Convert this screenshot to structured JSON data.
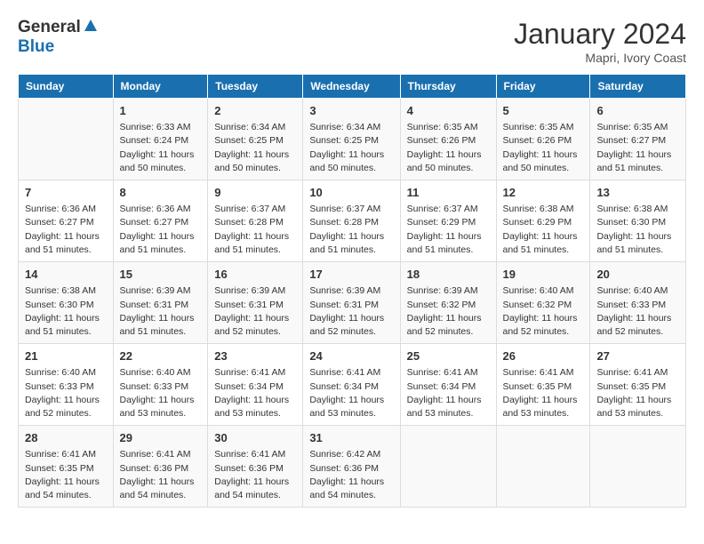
{
  "header": {
    "logo_general": "General",
    "logo_blue": "Blue",
    "month_title": "January 2024",
    "location": "Mapri, Ivory Coast"
  },
  "weekdays": [
    "Sunday",
    "Monday",
    "Tuesday",
    "Wednesday",
    "Thursday",
    "Friday",
    "Saturday"
  ],
  "rows": [
    [
      {
        "day": "",
        "info": ""
      },
      {
        "day": "1",
        "info": "Sunrise: 6:33 AM\nSunset: 6:24 PM\nDaylight: 11 hours\nand 50 minutes."
      },
      {
        "day": "2",
        "info": "Sunrise: 6:34 AM\nSunset: 6:25 PM\nDaylight: 11 hours\nand 50 minutes."
      },
      {
        "day": "3",
        "info": "Sunrise: 6:34 AM\nSunset: 6:25 PM\nDaylight: 11 hours\nand 50 minutes."
      },
      {
        "day": "4",
        "info": "Sunrise: 6:35 AM\nSunset: 6:26 PM\nDaylight: 11 hours\nand 50 minutes."
      },
      {
        "day": "5",
        "info": "Sunrise: 6:35 AM\nSunset: 6:26 PM\nDaylight: 11 hours\nand 50 minutes."
      },
      {
        "day": "6",
        "info": "Sunrise: 6:35 AM\nSunset: 6:27 PM\nDaylight: 11 hours\nand 51 minutes."
      }
    ],
    [
      {
        "day": "7",
        "info": "Sunrise: 6:36 AM\nSunset: 6:27 PM\nDaylight: 11 hours\nand 51 minutes."
      },
      {
        "day": "8",
        "info": "Sunrise: 6:36 AM\nSunset: 6:27 PM\nDaylight: 11 hours\nand 51 minutes."
      },
      {
        "day": "9",
        "info": "Sunrise: 6:37 AM\nSunset: 6:28 PM\nDaylight: 11 hours\nand 51 minutes."
      },
      {
        "day": "10",
        "info": "Sunrise: 6:37 AM\nSunset: 6:28 PM\nDaylight: 11 hours\nand 51 minutes."
      },
      {
        "day": "11",
        "info": "Sunrise: 6:37 AM\nSunset: 6:29 PM\nDaylight: 11 hours\nand 51 minutes."
      },
      {
        "day": "12",
        "info": "Sunrise: 6:38 AM\nSunset: 6:29 PM\nDaylight: 11 hours\nand 51 minutes."
      },
      {
        "day": "13",
        "info": "Sunrise: 6:38 AM\nSunset: 6:30 PM\nDaylight: 11 hours\nand 51 minutes."
      }
    ],
    [
      {
        "day": "14",
        "info": "Sunrise: 6:38 AM\nSunset: 6:30 PM\nDaylight: 11 hours\nand 51 minutes."
      },
      {
        "day": "15",
        "info": "Sunrise: 6:39 AM\nSunset: 6:31 PM\nDaylight: 11 hours\nand 51 minutes."
      },
      {
        "day": "16",
        "info": "Sunrise: 6:39 AM\nSunset: 6:31 PM\nDaylight: 11 hours\nand 52 minutes."
      },
      {
        "day": "17",
        "info": "Sunrise: 6:39 AM\nSunset: 6:31 PM\nDaylight: 11 hours\nand 52 minutes."
      },
      {
        "day": "18",
        "info": "Sunrise: 6:39 AM\nSunset: 6:32 PM\nDaylight: 11 hours\nand 52 minutes."
      },
      {
        "day": "19",
        "info": "Sunrise: 6:40 AM\nSunset: 6:32 PM\nDaylight: 11 hours\nand 52 minutes."
      },
      {
        "day": "20",
        "info": "Sunrise: 6:40 AM\nSunset: 6:33 PM\nDaylight: 11 hours\nand 52 minutes."
      }
    ],
    [
      {
        "day": "21",
        "info": "Sunrise: 6:40 AM\nSunset: 6:33 PM\nDaylight: 11 hours\nand 52 minutes."
      },
      {
        "day": "22",
        "info": "Sunrise: 6:40 AM\nSunset: 6:33 PM\nDaylight: 11 hours\nand 53 minutes."
      },
      {
        "day": "23",
        "info": "Sunrise: 6:41 AM\nSunset: 6:34 PM\nDaylight: 11 hours\nand 53 minutes."
      },
      {
        "day": "24",
        "info": "Sunrise: 6:41 AM\nSunset: 6:34 PM\nDaylight: 11 hours\nand 53 minutes."
      },
      {
        "day": "25",
        "info": "Sunrise: 6:41 AM\nSunset: 6:34 PM\nDaylight: 11 hours\nand 53 minutes."
      },
      {
        "day": "26",
        "info": "Sunrise: 6:41 AM\nSunset: 6:35 PM\nDaylight: 11 hours\nand 53 minutes."
      },
      {
        "day": "27",
        "info": "Sunrise: 6:41 AM\nSunset: 6:35 PM\nDaylight: 11 hours\nand 53 minutes."
      }
    ],
    [
      {
        "day": "28",
        "info": "Sunrise: 6:41 AM\nSunset: 6:35 PM\nDaylight: 11 hours\nand 54 minutes."
      },
      {
        "day": "29",
        "info": "Sunrise: 6:41 AM\nSunset: 6:36 PM\nDaylight: 11 hours\nand 54 minutes."
      },
      {
        "day": "30",
        "info": "Sunrise: 6:41 AM\nSunset: 6:36 PM\nDaylight: 11 hours\nand 54 minutes."
      },
      {
        "day": "31",
        "info": "Sunrise: 6:42 AM\nSunset: 6:36 PM\nDaylight: 11 hours\nand 54 minutes."
      },
      {
        "day": "",
        "info": ""
      },
      {
        "day": "",
        "info": ""
      },
      {
        "day": "",
        "info": ""
      }
    ]
  ]
}
